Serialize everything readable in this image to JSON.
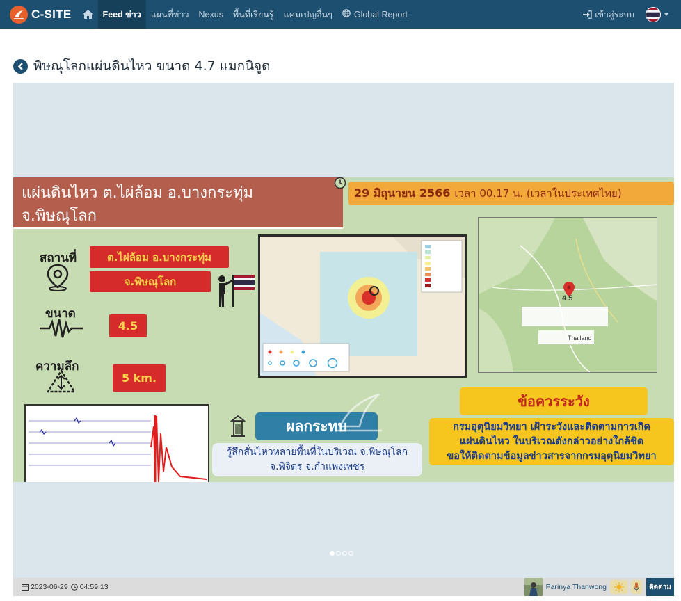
{
  "navbar": {
    "brand": "C-SITE",
    "items": [
      {
        "label": "Feed ข่าว",
        "active": true
      },
      {
        "label": "แผนที่ข่าว"
      },
      {
        "label": "Nexus"
      },
      {
        "label": "พื้นที่เรียนรู้"
      },
      {
        "label": "แคมเปญอื่นๆ"
      },
      {
        "label": "Global Report",
        "icon": "globe-icon"
      }
    ],
    "login_label": "เข้าสู่ระบบ",
    "language_icon": "thai-flag-icon"
  },
  "page": {
    "title": "พิษณุโลกแผ่นดินไหว ขนาด 4.7 แมกนิจูด"
  },
  "slide": {
    "header_line1": "แผ่นดินไหว ต.ไผ่ล้อม อ.บางกระทุ่ม",
    "header_line2": "จ.พิษณุโลก",
    "date_bold": "29 มิถุนายน 2566",
    "date_rest": "เวลา 00.17 น. (เวลาในประเทศไทย)",
    "location_label": "สถานที่",
    "location_line1": "ต.ไผ่ล้อม อ.บางกระทุ่ม",
    "location_line2": "จ.พิษณุโลก",
    "magnitude_label": "ขนาด",
    "magnitude_value": "4.5",
    "depth_label": "ความลึก",
    "depth_value": "5 km.",
    "warning_title": "ข้อควรระวัง",
    "warning_line1": "กรมอุตุนิยมวิทยา เฝ้าระวังและติดตามการเกิด",
    "warning_line2": "แผ่นดินไหว ในบริเวณดังกล่าวอย่างใกล้ชิด",
    "warning_line3": "ขอให้ติดตามข้อมูลข่าวสารจากกรมอุตุนิยมวิทยา",
    "impact_title": "ผลกระทบ",
    "impact_line1": "รู้สึกสั่นไหวหลายพื้นที่ในบริเวณ จ.พิษณุโลก",
    "impact_line2": "จ.พิจิตร จ.กำแพงเพชร",
    "gmap_marker": "4.5",
    "gmap_country": "Thailand",
    "slide_count": 4,
    "active_slide": 1
  },
  "footer": {
    "date": "2023-06-29",
    "time": "04:59:13",
    "author": "Parinya Thanwong",
    "follow_label": "ติดตาม"
  },
  "colors": {
    "navbar": "#1d4f70",
    "brand_logo": "#e8612c",
    "slide_bg": "#c7dcb2",
    "header_band": "#b45e4d",
    "accent_orange": "#f3a83a",
    "warning_yellow": "#f6c51e"
  }
}
